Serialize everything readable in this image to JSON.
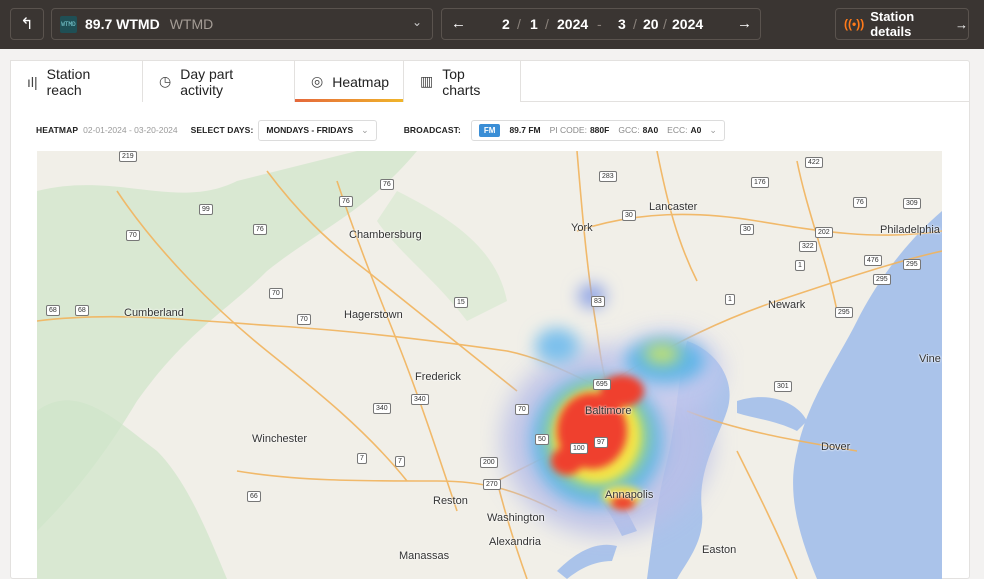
{
  "topbar": {
    "back_icon": "arrow-up-left-icon",
    "station": {
      "logo_text": "WTMD",
      "name": "89.7 WTMD",
      "call": "WTMD"
    },
    "date_range": {
      "start_month": "2",
      "start_day": "1",
      "start_year": "2024",
      "separator": "-",
      "end_month": "3",
      "end_day": "20",
      "end_year": "2024"
    },
    "details_label": "Station details"
  },
  "tabs": [
    {
      "label": "Station reach",
      "icon": "bar-chart-icon",
      "active": false
    },
    {
      "label": "Day part activity",
      "icon": "clock-icon",
      "active": false
    },
    {
      "label": "Heatmap",
      "icon": "heatmap-icon",
      "active": true
    },
    {
      "label": "Top charts",
      "icon": "chart-building-icon",
      "active": false
    }
  ],
  "filters": {
    "heatmap_label": "HEATMAP",
    "heatmap_range": "02-01-2024 - 03-20-2024",
    "days_label": "SELECT DAYS:",
    "days_value": "MONDAYS - FRIDAYS",
    "broadcast_label": "BROADCAST:",
    "band": "FM",
    "freq": "89.7 FM",
    "pi_label": "PI CODE:",
    "pi_value": "880F",
    "gcc_label": "GCC:",
    "gcc_value": "8A0",
    "ecc_label": "ECC:",
    "ecc_value": "A0"
  },
  "map": {
    "places": [
      "Lancaster",
      "Philadelphia",
      "York",
      "Chambersburg",
      "Cumberland",
      "Hagerstown",
      "Newark",
      "Frederick",
      "Baltimore",
      "Vine",
      "Winchester",
      "Dover",
      "Reston",
      "Washington",
      "Annapolis",
      "Alexandria",
      "Manassas",
      "Easton"
    ],
    "shields": [
      "219",
      "283",
      "422",
      "76",
      "176",
      "99",
      "76",
      "30",
      "76",
      "309",
      "70",
      "76",
      "30",
      "202",
      "322",
      "1",
      "476",
      "295",
      "295",
      "83",
      "15",
      "70",
      "1",
      "68",
      "68",
      "70",
      "295",
      "695",
      "70",
      "340",
      "340",
      "301",
      "270",
      "200",
      "7",
      "7",
      "66",
      "100",
      "50",
      "97"
    ]
  }
}
